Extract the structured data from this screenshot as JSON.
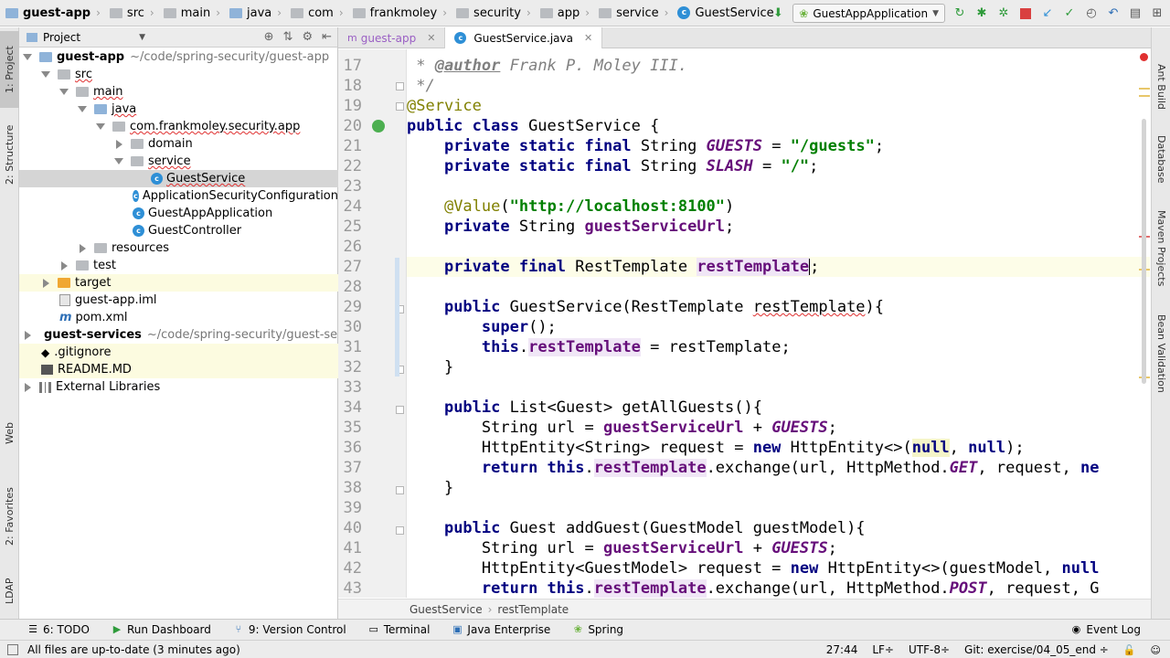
{
  "nav": {
    "crumbs": [
      "guest-app",
      "src",
      "main",
      "java",
      "com",
      "frankmoley",
      "security",
      "app",
      "service",
      "GuestService"
    ],
    "run_config": "GuestAppApplication"
  },
  "left_tabs": [
    "1: Project",
    "2: Structure",
    "Web",
    "2: Favorites",
    "LDAP"
  ],
  "right_tabs": [
    "Ant Build",
    "Database",
    "Maven Projects",
    "Bean Validation"
  ],
  "project": {
    "header": "Project",
    "tree": [
      {
        "label": "guest-app",
        "path": "~/code/spring-security/guest-app"
      },
      {
        "label": "src"
      },
      {
        "label": "main"
      },
      {
        "label": "java"
      },
      {
        "label": "com.frankmoley.security.app"
      },
      {
        "label": "domain"
      },
      {
        "label": "service"
      },
      {
        "label": "GuestService"
      },
      {
        "label": "ApplicationSecurityConfiguration"
      },
      {
        "label": "GuestAppApplication"
      },
      {
        "label": "GuestController"
      },
      {
        "label": "resources"
      },
      {
        "label": "test"
      },
      {
        "label": "target"
      },
      {
        "label": "guest-app.iml"
      },
      {
        "label": "pom.xml"
      },
      {
        "label": "guest-services",
        "path": "~/code/spring-security/guest-ser"
      },
      {
        "label": ".gitignore"
      },
      {
        "label": "README.MD"
      },
      {
        "label": "External Libraries"
      }
    ]
  },
  "editor": {
    "tabs": [
      "guest-app",
      "GuestService.java"
    ],
    "line_numbers": [
      "17",
      "18",
      "19",
      "20",
      "21",
      "22",
      "23",
      "24",
      "25",
      "26",
      "27",
      "28",
      "29",
      "30",
      "31",
      "32",
      "33",
      "34",
      "35",
      "36",
      "37",
      "38",
      "39",
      "40",
      "41",
      "42",
      "43"
    ],
    "breadcrumb": [
      "GuestService",
      "restTemplate"
    ],
    "code": {
      "l17_a": " * ",
      "l17_tag": "@author",
      "l17_b": " Frank P. Moley III.",
      "l18": " */",
      "l19": "@Service",
      "l20_kw": "public class",
      "l20_rest": " GuestService {",
      "l21_kw": "private static final",
      "l21_a": " String ",
      "l21_c": "GUESTS",
      "l21_b": " = ",
      "l21_s": "\"/guests\"",
      "l21_e": ";",
      "l22_kw": "private static final",
      "l22_a": " String ",
      "l22_c": "SLASH",
      "l22_b": " = ",
      "l22_s": "\"/\"",
      "l22_e": ";",
      "l24_ann": "@Value",
      "l24_a": "(",
      "l24_s": "\"http://localhost:8100\"",
      "l24_b": ")",
      "l25_kw": "private",
      "l25_a": " String ",
      "l25_f": "guestServiceUrl",
      "l25_b": ";",
      "l27_kw": "private final",
      "l27_a": " RestTemplate ",
      "l27_f": "restTemplate",
      "l27_b": ";",
      "l29_kw": "public",
      "l29_a": " GuestService(RestTemplate ",
      "l29_p": "restTemplate",
      "l29_b": "){",
      "l30_kw": "super",
      "l30_a": "();",
      "l31_kw": "this",
      "l31_a": ".",
      "l31_f": "restTemplate",
      "l31_b": " = restTemplate;",
      "l32": "}",
      "l34_kw": "public",
      "l34_a": " List<Guest> getAllGuests(){",
      "l35_a": "String url = ",
      "l35_f": "guestServiceUrl",
      "l35_b": " + ",
      "l35_c": "GUESTS",
      "l35_e": ";",
      "l36_a": "HttpEntity<String> request = ",
      "l36_kw": "new",
      "l36_b": " HttpEntity<>(",
      "l36_n1": "null",
      "l36_c": ", ",
      "l36_n2": "null",
      "l36_e": ");",
      "l37_kw": "return this",
      "l37_a": ".",
      "l37_f": "restTemplate",
      "l37_b": ".exchange(url, HttpMethod.",
      "l37_c": "GET",
      "l37_e": ", request, ",
      "l37_kw2": "ne",
      "l38": "}",
      "l40_kw": "public",
      "l40_a": " Guest addGuest(GuestModel guestModel){",
      "l41_a": "String url = ",
      "l41_f": "guestServiceUrl",
      "l41_b": " + ",
      "l41_c": "GUESTS",
      "l41_e": ";",
      "l42_a": "HttpEntity<GuestModel> request = ",
      "l42_kw": "new",
      "l42_b": " HttpEntity<>(guestModel, ",
      "l42_n": "null",
      "l43_kw": "return this",
      "l43_a": ".",
      "l43_f": "restTemplate",
      "l43_b": ".exchange(url, HttpMethod.",
      "l43_c": "POST",
      "l43_e": ", request, G"
    }
  },
  "bottom_tools": [
    "6: TODO",
    "Run Dashboard",
    "9: Version Control",
    "Terminal",
    "Java Enterprise",
    "Spring",
    "Event Log"
  ],
  "status": {
    "message": "All files are up-to-date (3 minutes ago)",
    "position": "27:44",
    "line_sep": "LF÷",
    "encoding": "UTF-8÷",
    "git": "Git: exercise/04_05_end ÷"
  },
  "colors": {
    "keyword": "#000080",
    "string": "#008000",
    "field": "#660e7a",
    "annotation": "#808000",
    "comment": "#808080"
  }
}
